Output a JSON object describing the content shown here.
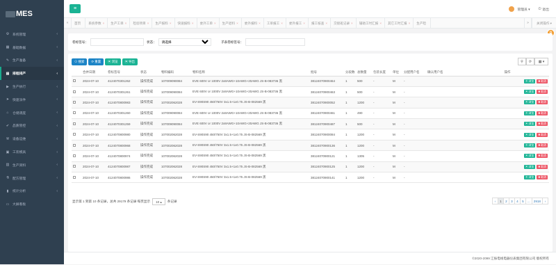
{
  "app": {
    "title": "MES"
  },
  "sidebar": {
    "items": [
      {
        "label": "系统管理",
        "icon": "gear-icon",
        "glyph": "⚙",
        "arrow": "‹"
      },
      {
        "label": "基础数据",
        "icon": "grid-icon",
        "glyph": "▦",
        "arrow": "‹"
      },
      {
        "label": "生产准备",
        "icon": "tool-icon",
        "glyph": "✎",
        "arrow": "‹"
      },
      {
        "label": "排程排产",
        "icon": "calendar-icon",
        "glyph": "▤",
        "arrow": "‹",
        "active": true
      },
      {
        "label": "生产执行",
        "icon": "play-icon",
        "glyph": "▶",
        "arrow": "‹"
      },
      {
        "label": "快速派件",
        "icon": "send-icon",
        "glyph": "➤",
        "arrow": "‹"
      },
      {
        "label": "仓储调度",
        "icon": "warehouse-icon",
        "glyph": "⌂",
        "arrow": "‹"
      },
      {
        "label": "品质管控",
        "icon": "check-icon",
        "glyph": "✔",
        "arrow": "‹"
      },
      {
        "label": "设备运维",
        "icon": "wrench-icon",
        "glyph": "⚒",
        "arrow": "‹"
      },
      {
        "label": "工装模具",
        "icon": "box-icon",
        "glyph": "▣",
        "arrow": "‹"
      },
      {
        "label": "生产资料",
        "icon": "folder-icon",
        "glyph": "▥",
        "arrow": "‹"
      },
      {
        "label": "配方管理",
        "icon": "flask-icon",
        "glyph": "⚗",
        "arrow": "‹"
      },
      {
        "label": "统计分析",
        "icon": "chart-icon",
        "glyph": "▮",
        "arrow": "‹"
      },
      {
        "label": "大屏看板",
        "icon": "monitor-icon",
        "glyph": "▭",
        "arrow": ""
      }
    ]
  },
  "topbar": {
    "menu_glyph": "≡",
    "user_name": "管理员 ▾",
    "logout_label": "退出",
    "logout_glyph": "⏻"
  },
  "tabs": {
    "left_arrow": "«",
    "right_arrow": "»",
    "close_ops": "关闭操作 ▾",
    "items": [
      {
        "label": "首页",
        "close": ""
      },
      {
        "label": "系统参数",
        "close": "×"
      },
      {
        "label": "生产工单",
        "close": "×"
      },
      {
        "label": "检验项目",
        "close": "×"
      },
      {
        "label": "生产报料",
        "close": "×"
      },
      {
        "label": "快速报料",
        "close": "×"
      },
      {
        "label": "委外工单",
        "close": "×"
      },
      {
        "label": "生产退料",
        "close": "×"
      },
      {
        "label": "委外报料",
        "close": "×"
      },
      {
        "label": "工单报工",
        "close": "×"
      },
      {
        "label": "委外报工",
        "close": "×"
      },
      {
        "label": "报工核查",
        "close": "×"
      },
      {
        "label": "交接班记录",
        "close": "×"
      },
      {
        "label": "辅助工时汇报",
        "close": "×"
      },
      {
        "label": "其它工时汇报",
        "close": "×"
      },
      {
        "label": "生产检",
        "close": ""
      }
    ]
  },
  "search": {
    "batch_label": "卷标签号：",
    "batch_value": "",
    "status_label": "状态：",
    "status_value": "请选择",
    "child_label": "子表卷标签号：",
    "child_value": ""
  },
  "toolbar": {
    "search": "⊙ 搜索",
    "reset": "⟳ 重置",
    "view": "▣ 浏览",
    "export": "▣ 导出"
  },
  "right_tools": {
    "search_glyph": "⚲",
    "refresh_glyph": "⟳",
    "columns_glyph": "▦ ▾"
  },
  "table": {
    "headers": [
      "",
      "合并日期",
      "卷标签号",
      "状态",
      "物料编码",
      "物料名称",
      "批号",
      "分段数",
      "总数量",
      "包装长度",
      "单位",
      "分配用户名",
      "确认用户名",
      "操作"
    ],
    "view_btn": "▣ 浏览",
    "cancel_btn": "✖ 取消",
    "rows": [
      [
        "",
        "2024-07-10",
        "4124070301262",
        "操作完成",
        "107009090084",
        "EVE 600V or 1000V 2x8AWG+10AWG+20AWG JS-B-083736 黑",
        "38124070900464",
        "1",
        "500",
        "-",
        "M",
        "-",
        ""
      ],
      [
        "",
        "2024-07-10",
        "4124070301261",
        "操作完成",
        "107009090084",
        "EVE 600V or 1000V 2x8AWG+10AWG+20AWG JS-B-083736 黑",
        "38124070900463",
        "1",
        "500",
        "-",
        "M",
        "-",
        ""
      ],
      [
        "",
        "2024-07-10",
        "4124070800983",
        "操作完成",
        "107002062028",
        "EV-S90S90 450/750V 3x1.5+1x0.75 JS-B-082569 黑",
        "38124070900052",
        "1",
        "1200",
        "-",
        "M",
        "-",
        ""
      ],
      [
        "",
        "2024-07-10",
        "4124070301260",
        "操作完成",
        "107009090084",
        "EVE 600V or 1000V 2x8AWG+10AWG+20AWG JS-B-083736 黑",
        "38124070900461",
        "1",
        "490",
        "-",
        "M",
        "-",
        ""
      ],
      [
        "",
        "2024-07-10",
        "4124070301259",
        "操作完成",
        "107009090084",
        "EVE 600V or 1000V 2x8AWG+10AWG+20AWG JS-B-083736 黑",
        "38124070900487",
        "1",
        "500",
        "-",
        "M",
        "-",
        ""
      ],
      [
        "",
        "2024-07-10",
        "4124070800980",
        "操作完成",
        "107002062028",
        "EV-S90S90 450/750V 3x1.5+1x0.75 JS-B-082569 黑",
        "38124070900084",
        "1",
        "1200",
        "-",
        "M",
        "-",
        ""
      ],
      [
        "",
        "2024-07-10",
        "4124070800968",
        "操作完成",
        "107002062028",
        "EV-S90S90 450/750V 3x1.5+1x0.75 JS-B-082569 黑",
        "38124070900136",
        "1",
        "1200",
        "-",
        "M",
        "-",
        ""
      ],
      [
        "",
        "2024-07-10",
        "4124070800974",
        "操作完成",
        "107002062028",
        "EV-S90S90 450/750V 3x1.5+1x0.75 JS-B-082569 黑",
        "38124070900121",
        "1",
        "1305",
        "-",
        "M",
        "-",
        ""
      ],
      [
        "",
        "2024-07-10",
        "4124070800987",
        "操作完成",
        "107002062028",
        "EV-S90S90 450/750V 3x1.5+1x0.75 JS-B-082569 黑",
        "38124070900125",
        "1",
        "1200",
        "-",
        "M",
        "-",
        ""
      ],
      [
        "",
        "2024-07-10",
        "4124070800986",
        "操作完成",
        "107002062028",
        "EV-S90S90 450/750V 3x1.5+1x0.75 JS-B-082569 黑",
        "38124070900141",
        "1",
        "1200",
        "-",
        "M",
        "-",
        ""
      ]
    ]
  },
  "pagination": {
    "info_prefix": "显示第 1 到第 10 条记录，总共 29179 条记录 每页显示",
    "page_size": "10 ▴",
    "info_suffix": "条记录",
    "pages": [
      "‹",
      "1",
      "2",
      "3",
      "4",
      "5",
      "...",
      "2918",
      "›"
    ],
    "active_page": "1"
  },
  "footer": {
    "text": "©2020-2099 江振电线电器仪表集团有限公司 版权所有"
  },
  "float_button": {
    "glyph": "✿"
  }
}
